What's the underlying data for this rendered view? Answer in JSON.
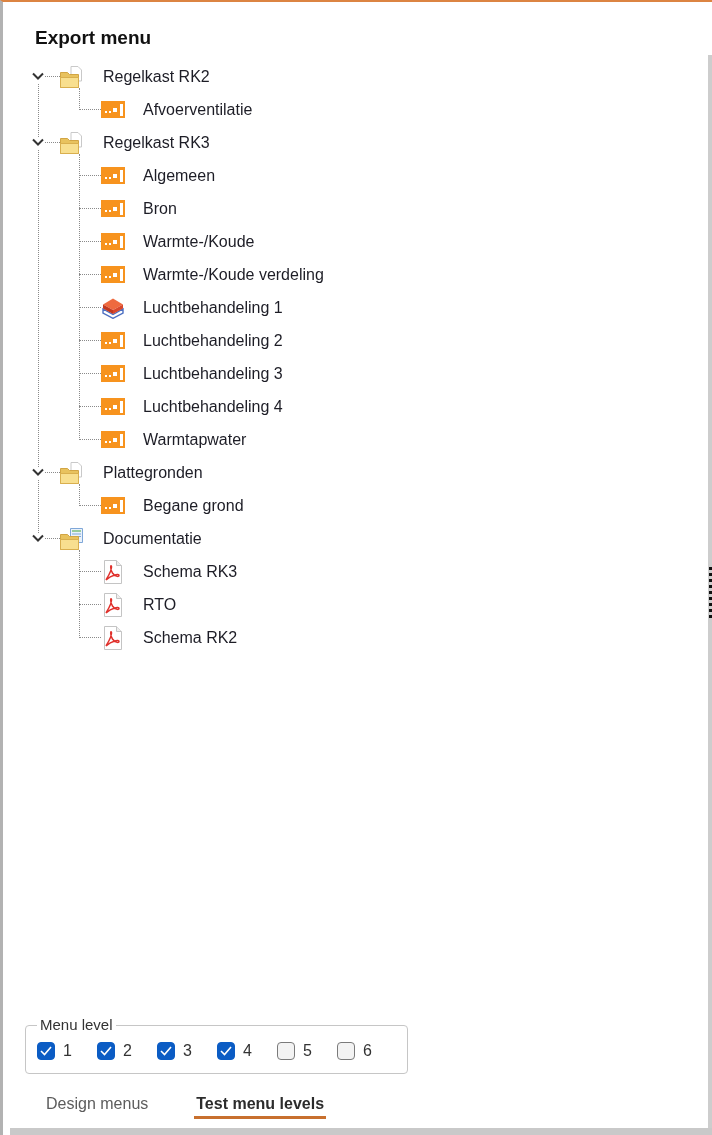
{
  "title": "Export menu",
  "tree": [
    {
      "label": "Regelkast RK2",
      "kind": "folder",
      "expanded": true,
      "children": [
        {
          "label": "Afvoerventilatie",
          "kind": "panel"
        }
      ]
    },
    {
      "label": "Regelkast RK3",
      "kind": "folder",
      "expanded": true,
      "children": [
        {
          "label": "Algemeen",
          "kind": "panel"
        },
        {
          "label": "Bron",
          "kind": "panel"
        },
        {
          "label": "Warmte-/Koude",
          "kind": "panel"
        },
        {
          "label": "Warmte-/Koude verdeling",
          "kind": "panel"
        },
        {
          "label": "Luchtbehandeling 1",
          "kind": "cube"
        },
        {
          "label": "Luchtbehandeling 2",
          "kind": "panel"
        },
        {
          "label": "Luchtbehandeling 3",
          "kind": "panel"
        },
        {
          "label": "Luchtbehandeling 4",
          "kind": "panel"
        },
        {
          "label": "Warmtapwater",
          "kind": "panel"
        }
      ]
    },
    {
      "label": "Plattegronden",
      "kind": "folder",
      "expanded": true,
      "children": [
        {
          "label": "Begane grond",
          "kind": "panel"
        }
      ]
    },
    {
      "label": "Documentatie",
      "kind": "document_folder",
      "expanded": true,
      "children": [
        {
          "label": "Schema RK3",
          "kind": "pdf"
        },
        {
          "label": "RTO",
          "kind": "pdf"
        },
        {
          "label": "Schema RK2",
          "kind": "pdf"
        }
      ]
    }
  ],
  "menu_level": {
    "legend": "Menu level",
    "options": [
      {
        "label": "1",
        "checked": true
      },
      {
        "label": "2",
        "checked": true
      },
      {
        "label": "3",
        "checked": true
      },
      {
        "label": "4",
        "checked": true
      },
      {
        "label": "5",
        "checked": false
      },
      {
        "label": "6",
        "checked": false
      }
    ]
  },
  "tabs": [
    {
      "label": "Design menus",
      "selected": false
    },
    {
      "label": "Test menu levels",
      "selected": true
    }
  ]
}
